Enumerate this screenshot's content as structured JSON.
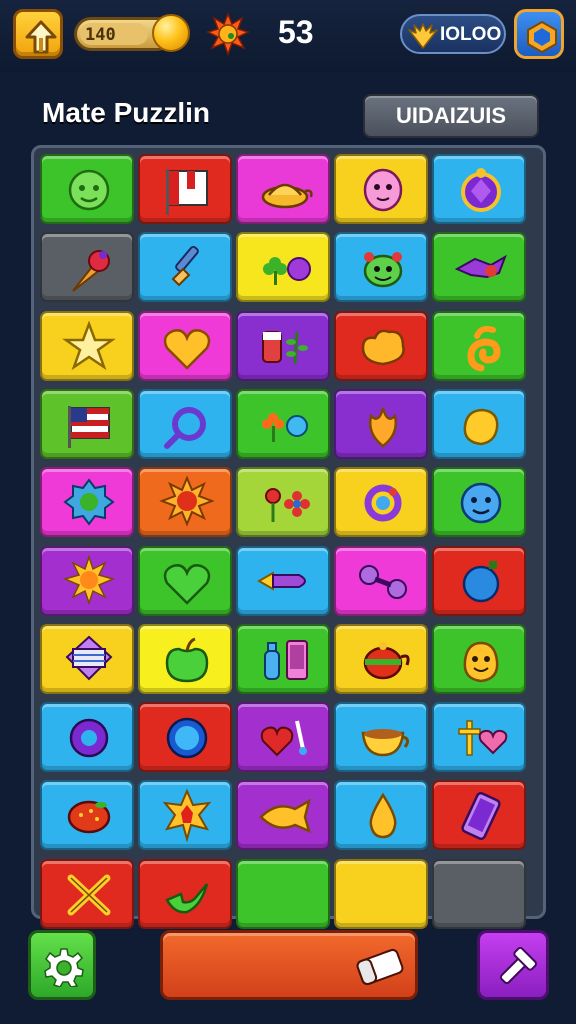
{
  "hud": {
    "coins_label": "140",
    "coin_bar_level": 0.72,
    "score": "53",
    "gems_label": "IOLOO",
    "home_icon": "arrow-up-home-icon",
    "coin_icon": "gold-coin-icon",
    "sun_icon": "sun-icon",
    "gem_icon": "golden-wings-icon",
    "menu_icon": "blue-shield-icon"
  },
  "header": {
    "title": "Mate Puzzlin",
    "button_label": "UIDAIZUIS"
  },
  "board": {
    "columns": 5,
    "rows": 10,
    "tiles": [
      {
        "color": "#3cc42a",
        "icon": "green-face-icon"
      },
      {
        "color": "#e02a1f",
        "icon": "flag-icon"
      },
      {
        "color": "#e93ad8",
        "icon": "lamp-icon"
      },
      {
        "color": "#f7d11e",
        "icon": "pink-face-icon"
      },
      {
        "color": "#2fb3ee",
        "icon": "purple-jewel-icon"
      },
      {
        "color": "#5a5f66",
        "icon": "ice-cream-icon"
      },
      {
        "color": "#2fb3ee",
        "icon": "brush-icon"
      },
      {
        "color": "#f7e51e",
        "icon": "clover-and-ball-icon"
      },
      {
        "color": "#2fb3ee",
        "icon": "green-monster-icon"
      },
      {
        "color": "#3cc42a",
        "icon": "purple-bird-icon"
      },
      {
        "color": "#f7d11e",
        "icon": "star-icon"
      },
      {
        "color": "#ef3ad8",
        "icon": "heart-icon"
      },
      {
        "color": "#8a2fcf",
        "icon": "drink-and-leaf-icon"
      },
      {
        "color": "#e02a1f",
        "icon": "cloud-heart-icon"
      },
      {
        "color": "#3cc42a",
        "icon": "swirl-icon"
      },
      {
        "color": "#5ec22a",
        "icon": "usa-flag-icon"
      },
      {
        "color": "#2fb3ee",
        "icon": "magnifier-icon"
      },
      {
        "color": "#3cc42a",
        "icon": "flower-and-ball-icon"
      },
      {
        "color": "#8a2fcf",
        "icon": "leaf-icon"
      },
      {
        "color": "#2fb3ee",
        "icon": "yellow-blob-icon"
      },
      {
        "color": "#ef3ad8",
        "icon": "blue-badge-icon"
      },
      {
        "color": "#f06a1e",
        "icon": "red-sun-icon"
      },
      {
        "color": "#a4d63a",
        "icon": "rose-and-flower-icon"
      },
      {
        "color": "#f7d11e",
        "icon": "ring-icon"
      },
      {
        "color": "#3cc42a",
        "icon": "blue-face-icon"
      },
      {
        "color": "#a32fcf",
        "icon": "sun-icon"
      },
      {
        "color": "#3cc42a",
        "icon": "green-heart-icon"
      },
      {
        "color": "#2fb3ee",
        "icon": "rocket-icon"
      },
      {
        "color": "#ef3ad8",
        "icon": "dumbbell-icon"
      },
      {
        "color": "#e02a1f",
        "icon": "blue-ball-icon"
      },
      {
        "color": "#f7d11e",
        "icon": "gift-icon"
      },
      {
        "color": "#f7f01e",
        "icon": "apple-icon"
      },
      {
        "color": "#3cc42a",
        "icon": "bottle-and-phone-icon"
      },
      {
        "color": "#f7d11e",
        "icon": "teapot-icon"
      },
      {
        "color": "#3cc42a",
        "icon": "yellow-smile-icon"
      },
      {
        "color": "#2fb3ee",
        "icon": "purple-donut-icon"
      },
      {
        "color": "#e02a1f",
        "icon": "blue-ring-icon"
      },
      {
        "color": "#a32fcf",
        "icon": "heart-and-pin-icon"
      },
      {
        "color": "#2fb3ee",
        "icon": "teacup-icon"
      },
      {
        "color": "#2fb3ee",
        "icon": "cross-and-heart-icon"
      },
      {
        "color": "#2fb3ee",
        "icon": "strawberry-icon"
      },
      {
        "color": "#2fb3ee",
        "icon": "red-star-icon"
      },
      {
        "color": "#a32fcf",
        "icon": "gold-fish-icon"
      },
      {
        "color": "#2fb3ee",
        "icon": "drop-icon"
      },
      {
        "color": "#e02a1f",
        "icon": "phone-icon"
      },
      {
        "color": "#e02a1f",
        "icon": "crossed-swords-icon"
      },
      {
        "color": "#e02a1f",
        "icon": "check-icon"
      },
      {
        "color": "#3cc42a",
        "icon": ""
      },
      {
        "color": "#f7d11e",
        "icon": ""
      },
      {
        "color": "#5a5f66",
        "icon": ""
      }
    ]
  },
  "footer": {
    "settings_icon": "gear-icon",
    "action_icon": "eraser-icon",
    "tool_icon": "pick-tool-icon"
  }
}
